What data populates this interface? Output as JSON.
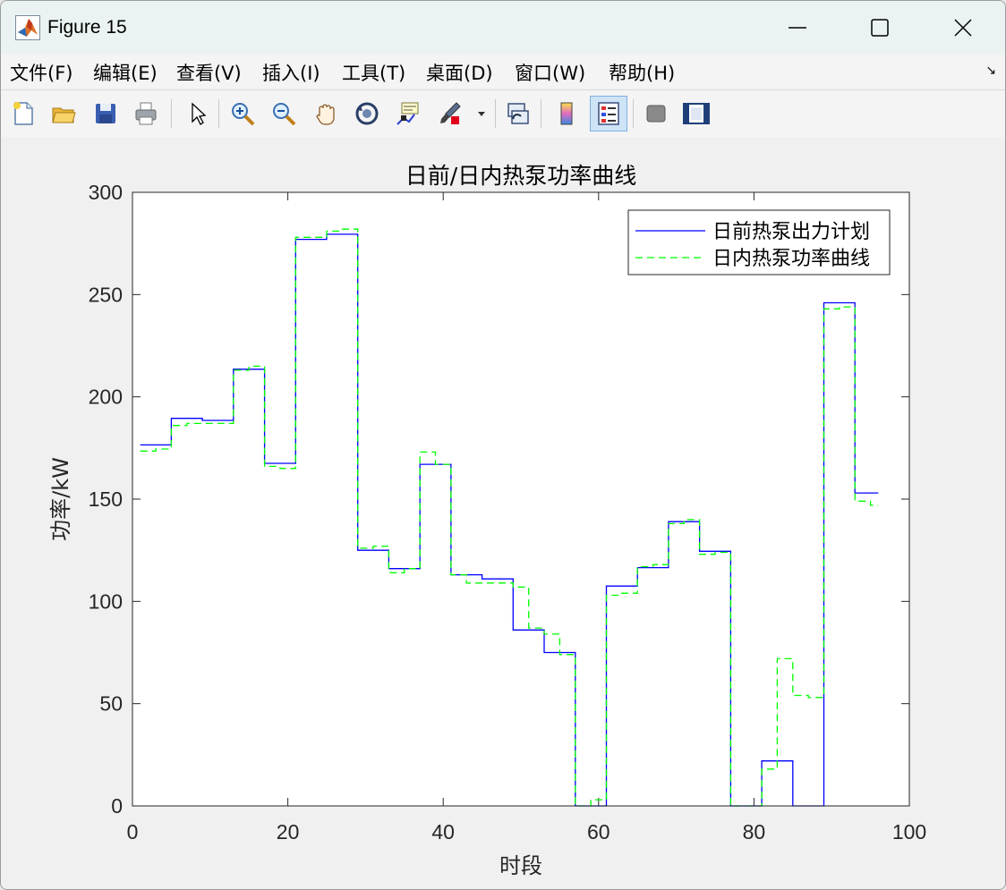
{
  "window": {
    "title": "Figure 15",
    "minimize_glyph": "—",
    "maximize_glyph": "☐",
    "close_glyph": "✕"
  },
  "menu": {
    "items": [
      "文件(F)",
      "编辑(E)",
      "查看(V)",
      "插入(I)",
      "工具(T)",
      "桌面(D)",
      "窗口(W)",
      "帮助(H)"
    ],
    "dock_glyph": "↘"
  },
  "toolbar": {
    "icons": [
      "new-figure-icon",
      "open-file-icon",
      "save-icon",
      "print-icon",
      "pointer-icon",
      "zoom-in-icon",
      "zoom-out-icon",
      "pan-hand-icon",
      "rotate-3d-icon",
      "data-cursor-icon",
      "brush-icon",
      "link-plot-icon",
      "colorbar-icon",
      "legend-icon",
      "hide-plot-tools-icon",
      "show-plot-tools-icon"
    ]
  },
  "chart_data": {
    "type": "line",
    "title": "日前/日内热泵功率曲线",
    "xlabel": "时段",
    "ylabel": "功率/kW",
    "xlim": [
      0,
      100
    ],
    "ylim": [
      0,
      300
    ],
    "xticks": [
      0,
      20,
      40,
      60,
      80,
      100
    ],
    "yticks": [
      0,
      50,
      100,
      150,
      200,
      250,
      300
    ],
    "grid": false,
    "legend_position": "top-right",
    "series": [
      {
        "name": "日前热泵出力计划",
        "style": "solid",
        "color": "#0000ff",
        "x": [
          1,
          5,
          9,
          13,
          17,
          21,
          25,
          29,
          33,
          37,
          41,
          45,
          49,
          53,
          57,
          61,
          65,
          69,
          73,
          77,
          81,
          85,
          89,
          93,
          96
        ],
        "y": [
          176.5,
          189.5,
          188.5,
          213.5,
          167.5,
          277,
          279.5,
          125,
          116,
          167,
          113,
          111,
          86,
          75,
          0,
          107.5,
          116.5,
          139,
          124.5,
          0,
          22,
          0,
          246,
          153,
          153
        ]
      },
      {
        "name": "日内热泵功率曲线",
        "style": "dashed",
        "color": "#00ff00",
        "x": [
          1,
          3,
          5,
          7,
          9,
          11,
          13,
          15,
          17,
          19,
          21,
          23,
          25,
          27,
          29,
          31,
          33,
          35,
          37,
          39,
          41,
          43,
          45,
          47,
          49,
          51,
          53,
          55,
          57,
          59,
          61,
          63,
          65,
          67,
          69,
          71,
          73,
          75,
          77,
          79,
          81,
          83,
          85,
          87,
          89,
          91,
          93,
          95,
          96
        ],
        "y": [
          173.5,
          174.5,
          186,
          187,
          187,
          187,
          213,
          215,
          166,
          165,
          278,
          278,
          281,
          282,
          126,
          127,
          114,
          116,
          173,
          167,
          113,
          109,
          109,
          109,
          107,
          87,
          84,
          74,
          0,
          3,
          103,
          104,
          117,
          118,
          138,
          140,
          123,
          124,
          0,
          0,
          18,
          72,
          54,
          53,
          243,
          244,
          149,
          147,
          147
        ]
      }
    ]
  }
}
